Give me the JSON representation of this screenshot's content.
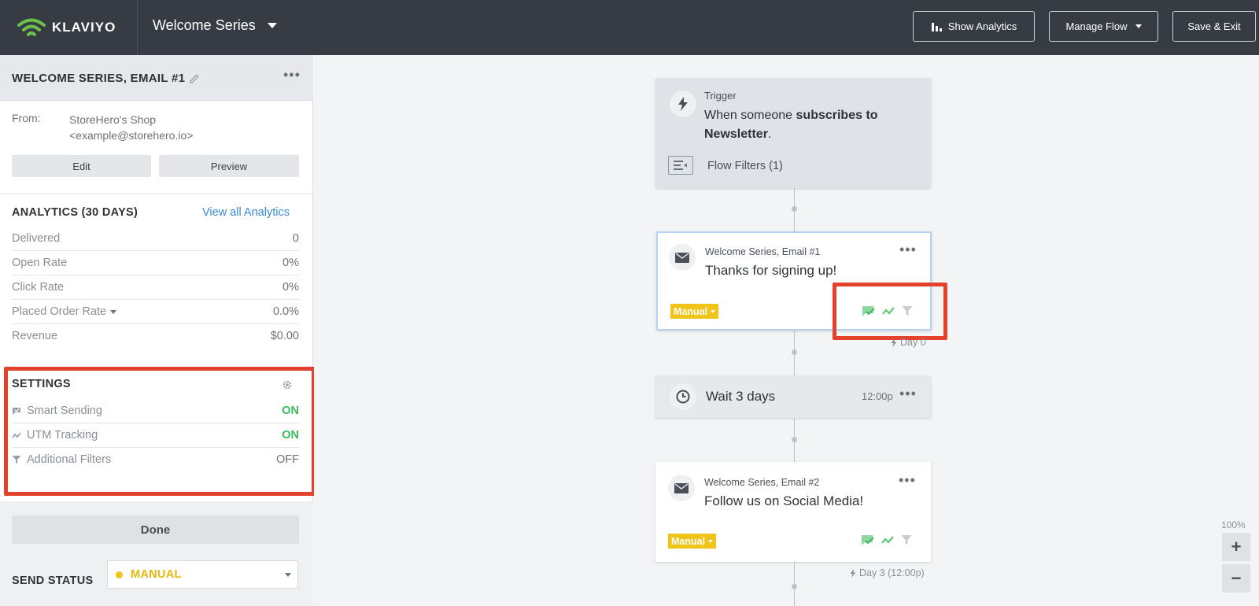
{
  "header": {
    "logo": "KLAVIYO",
    "flow_name": "Welcome Series",
    "buttons": {
      "show_analytics": "Show Analytics",
      "manage_flow": "Manage Flow",
      "save_exit": "Save & Exit"
    }
  },
  "sidebar": {
    "title": "WELCOME SERIES, EMAIL #1",
    "from_label": "From:",
    "from_name": "StoreHero's Shop",
    "from_email": "<example@storehero.io>",
    "edit_label": "Edit",
    "preview_label": "Preview",
    "analytics": {
      "title": "ANALYTICS (30 DAYS)",
      "view_all": "View all Analytics",
      "rows": [
        {
          "label": "Delivered",
          "value": "0"
        },
        {
          "label": "Open Rate",
          "value": "0%"
        },
        {
          "label": "Click Rate",
          "value": "0%"
        },
        {
          "label": "Placed Order Rate",
          "value": "0.0%"
        },
        {
          "label": "Revenue",
          "value": "$0.00"
        }
      ]
    },
    "settings": {
      "title": "SETTINGS",
      "rows": [
        {
          "label": "Smart Sending",
          "value": "ON"
        },
        {
          "label": "UTM Tracking",
          "value": "ON"
        },
        {
          "label": "Additional Filters",
          "value": "OFF"
        }
      ]
    },
    "done_label": "Done",
    "send_status_label": "SEND STATUS",
    "send_status_value": "MANUAL"
  },
  "canvas": {
    "trigger": {
      "label": "Trigger",
      "text_prefix": "When someone",
      "text_bold": "subscribes to Newsletter",
      "text_suffix": ".",
      "flow_filters": "Flow Filters (1)"
    },
    "email1": {
      "subtitle": "Welcome Series, Email #1",
      "title": "Thanks for signing up!",
      "badge": "Manual",
      "day": "Day 0"
    },
    "wait": {
      "text": "Wait 3 days",
      "time": "12:00p"
    },
    "email2": {
      "subtitle": "Welcome Series, Email #2",
      "title": "Follow us on Social Media!",
      "badge": "Manual",
      "day": "Day 3 (12:00p)"
    },
    "zoom": {
      "level": "100%",
      "plus": "+",
      "minus": "−"
    }
  },
  "colors": {
    "topbar": "#373c44",
    "highlight": "#e4412d",
    "on": "#3cba5c",
    "manual": "#f0c419",
    "link": "#3a8ad0"
  }
}
